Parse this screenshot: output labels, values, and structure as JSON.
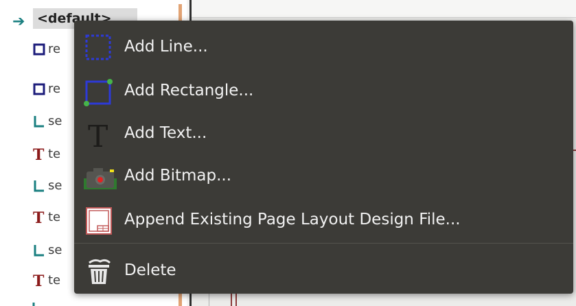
{
  "tree": {
    "root_label": "<default>",
    "items": [
      {
        "icon": "rect-outline-icon",
        "text": "re"
      },
      {
        "icon": "rect-outline-icon",
        "text": "re"
      },
      {
        "icon": "segment-icon",
        "text": "se"
      },
      {
        "icon": "text-t-icon",
        "text": "te"
      },
      {
        "icon": "segment-icon",
        "text": "se"
      },
      {
        "icon": "text-t-icon",
        "text": "te"
      },
      {
        "icon": "segment-icon",
        "text": "se"
      },
      {
        "icon": "text-t-icon",
        "text": "te"
      }
    ]
  },
  "menu": {
    "add_line": "Add Line...",
    "add_rectangle": "Add Rectangle...",
    "add_text": "Add Text...",
    "add_bitmap": "Add Bitmap...",
    "append_layout": "Append Existing Page Layout Design File...",
    "delete": "Delete"
  },
  "colors": {
    "menu_bg": "#3c3b37",
    "menu_text": "#f2f2f2",
    "tree_teal": "#1a7f80",
    "tree_navy": "#1b1b7a",
    "tree_red": "#8b1a1a",
    "accent_orange": "#e2a374"
  }
}
